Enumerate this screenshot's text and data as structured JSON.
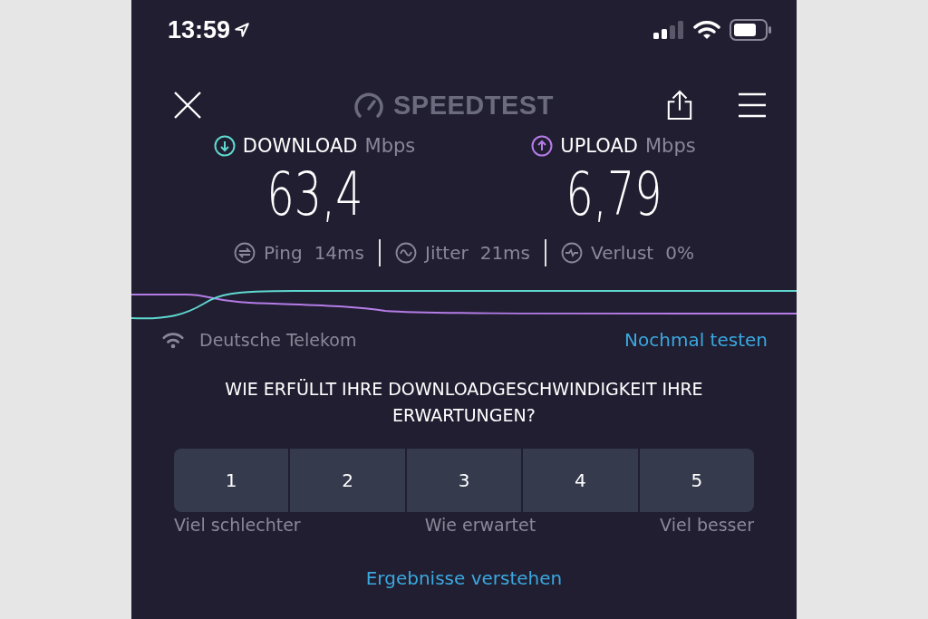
{
  "status_bar": {
    "time": "13:59"
  },
  "header": {
    "logo": "SPEEDTEST"
  },
  "results": [
    {
      "kind": "download",
      "label": "DOWNLOAD",
      "unit": "Mbps",
      "value": "63,4",
      "color": "#5fd8d0"
    },
    {
      "kind": "upload",
      "label": "UPLOAD",
      "unit": "Mbps",
      "value": "6,79",
      "color": "#b57ce8"
    }
  ],
  "stats": [
    {
      "kind": "ping",
      "label": "Ping",
      "value": "14ms"
    },
    {
      "kind": "jitter",
      "label": "Jitter",
      "value": "21ms"
    },
    {
      "kind": "loss",
      "label": "Verlust",
      "value": "0%"
    }
  ],
  "connection": {
    "provider": "Deutsche Telekom",
    "retest": "Nochmal testen"
  },
  "survey": {
    "question": "WIE ERFÜLLT IHRE DOWNLOADGESCHWINDIGKEIT IHRE ERWARTUNGEN?",
    "options": [
      {
        "label": "1",
        "selected": false
      },
      {
        "label": "2",
        "selected": false
      },
      {
        "label": "3",
        "selected": false
      },
      {
        "label": "4",
        "selected": false
      },
      {
        "label": "5",
        "selected": false
      }
    ],
    "scale_labels": [
      "Viel schlechter",
      "Wie erwartet",
      "Viel besser"
    ]
  },
  "footer_link": "Ergebnisse verstehen"
}
